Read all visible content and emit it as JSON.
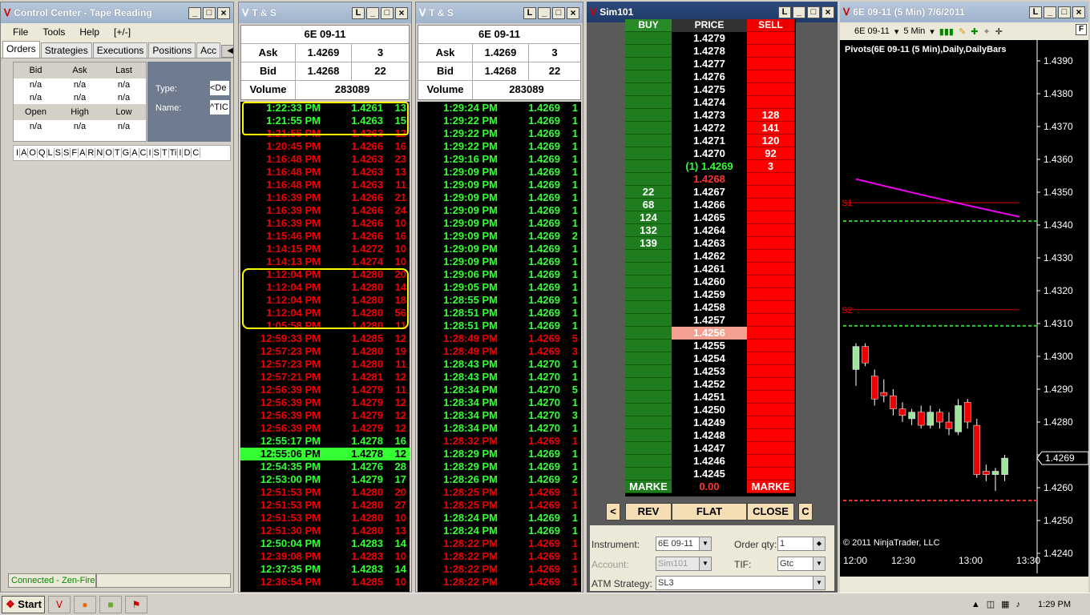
{
  "cc": {
    "title": "Control Center - Tape Reading",
    "menu": [
      "File",
      "Tools",
      "Help",
      "[+/-]"
    ],
    "tabs": [
      "Orders",
      "Strategies",
      "Executions",
      "Positions",
      "Acc"
    ],
    "quote_headers1": [
      "Bid",
      "Ask",
      "Last"
    ],
    "quote_rows1": [
      [
        "n/a",
        "n/a",
        "n/a"
      ],
      [
        "n/a",
        "n/a",
        "n/a"
      ]
    ],
    "quote_headers2": [
      "Open",
      "High",
      "Low"
    ],
    "quote_rows2": [
      [
        "n/a",
        "n/a",
        "n/a"
      ]
    ],
    "type_label": "Type:",
    "type_value": "<De",
    "name_label": "Name:",
    "name_value": "^TIC",
    "column_letters": [
      "I",
      "A",
      "O",
      "Q",
      "L",
      "S",
      "S",
      "F",
      "A",
      "R",
      "N",
      "O",
      "T",
      "G",
      "A",
      "C",
      "I",
      "S",
      "T",
      "Ti",
      "I",
      "D",
      "C"
    ],
    "status": "Connected - Zen-Fire"
  },
  "ts1": {
    "title": "T & S",
    "instrument": "6E 09-11",
    "ask_label": "Ask",
    "ask_price": "1.4269",
    "ask_size": "3",
    "bid_label": "Bid",
    "bid_price": "1.4268",
    "bid_size": "22",
    "vol_label": "Volume",
    "volume": "283089",
    "rows": [
      [
        "1:22:33 PM",
        "1.4261",
        "13",
        "g"
      ],
      [
        "1:21:55 PM",
        "1.4263",
        "15",
        "g"
      ],
      [
        "1:21:55 PM",
        "1.4263",
        "12",
        "r"
      ],
      [
        "1:20:45 PM",
        "1.4266",
        "16",
        "r"
      ],
      [
        "1:16:48 PM",
        "1.4263",
        "23",
        "r"
      ],
      [
        "1:16:48 PM",
        "1.4263",
        "13",
        "r"
      ],
      [
        "1:16:48 PM",
        "1.4263",
        "11",
        "r"
      ],
      [
        "1:16:39 PM",
        "1.4266",
        "21",
        "r"
      ],
      [
        "1:16:39 PM",
        "1.4266",
        "24",
        "r"
      ],
      [
        "1:16:39 PM",
        "1.4266",
        "10",
        "r"
      ],
      [
        "1:15:46 PM",
        "1.4266",
        "16",
        "r"
      ],
      [
        "1:14:15 PM",
        "1.4272",
        "10",
        "r"
      ],
      [
        "1:14:13 PM",
        "1.4274",
        "10",
        "r"
      ],
      [
        "1:12:04 PM",
        "1.4280",
        "20",
        "r"
      ],
      [
        "1:12:04 PM",
        "1.4280",
        "14",
        "r"
      ],
      [
        "1:12:04 PM",
        "1.4280",
        "18",
        "r"
      ],
      [
        "1:12:04 PM",
        "1.4280",
        "56",
        "r"
      ],
      [
        "1:05:58 PM",
        "1.4280",
        "11",
        "r"
      ],
      [
        "12:59:33 PM",
        "1.4285",
        "12",
        "r"
      ],
      [
        "12:57:23 PM",
        "1.4280",
        "19",
        "r"
      ],
      [
        "12:57:23 PM",
        "1.4280",
        "11",
        "r"
      ],
      [
        "12:57:21 PM",
        "1.4281",
        "12",
        "r"
      ],
      [
        "12:56:39 PM",
        "1.4279",
        "11",
        "r"
      ],
      [
        "12:56:39 PM",
        "1.4279",
        "12",
        "r"
      ],
      [
        "12:56:39 PM",
        "1.4279",
        "12",
        "r"
      ],
      [
        "12:56:39 PM",
        "1.4279",
        "12",
        "r"
      ],
      [
        "12:55:17 PM",
        "1.4278",
        "16",
        "g"
      ],
      [
        "12:55:06 PM",
        "1.4278",
        "12",
        "hl"
      ],
      [
        "12:54:35 PM",
        "1.4276",
        "28",
        "g"
      ],
      [
        "12:53:00 PM",
        "1.4279",
        "17",
        "g"
      ],
      [
        "12:51:53 PM",
        "1.4280",
        "20",
        "r"
      ],
      [
        "12:51:53 PM",
        "1.4280",
        "27",
        "r"
      ],
      [
        "12:51:53 PM",
        "1.4280",
        "10",
        "r"
      ],
      [
        "12:51:30 PM",
        "1.4280",
        "13",
        "r"
      ],
      [
        "12:50:04 PM",
        "1.4283",
        "14",
        "g"
      ],
      [
        "12:39:08 PM",
        "1.4283",
        "10",
        "r"
      ],
      [
        "12:37:35 PM",
        "1.4283",
        "14",
        "g"
      ],
      [
        "12:36:54 PM",
        "1.4285",
        "10",
        "r"
      ]
    ]
  },
  "ts2": {
    "title": "T & S",
    "instrument": "6E 09-11",
    "ask_label": "Ask",
    "ask_price": "1.4269",
    "ask_size": "3",
    "bid_label": "Bid",
    "bid_price": "1.4268",
    "bid_size": "22",
    "vol_label": "Volume",
    "volume": "283089",
    "rows": [
      [
        "1:29:24 PM",
        "1.4269",
        "1",
        "g"
      ],
      [
        "1:29:22 PM",
        "1.4269",
        "1",
        "g"
      ],
      [
        "1:29:22 PM",
        "1.4269",
        "1",
        "g"
      ],
      [
        "1:29:22 PM",
        "1.4269",
        "1",
        "g"
      ],
      [
        "1:29:16 PM",
        "1.4269",
        "1",
        "g"
      ],
      [
        "1:29:09 PM",
        "1.4269",
        "1",
        "g"
      ],
      [
        "1:29:09 PM",
        "1.4269",
        "1",
        "g"
      ],
      [
        "1:29:09 PM",
        "1.4269",
        "1",
        "g"
      ],
      [
        "1:29:09 PM",
        "1.4269",
        "1",
        "g"
      ],
      [
        "1:29:09 PM",
        "1.4269",
        "1",
        "g"
      ],
      [
        "1:29:09 PM",
        "1.4269",
        "2",
        "g"
      ],
      [
        "1:29:09 PM",
        "1.4269",
        "1",
        "g"
      ],
      [
        "1:29:09 PM",
        "1.4269",
        "1",
        "g"
      ],
      [
        "1:29:06 PM",
        "1.4269",
        "1",
        "g"
      ],
      [
        "1:29:05 PM",
        "1.4269",
        "1",
        "g"
      ],
      [
        "1:28:55 PM",
        "1.4269",
        "1",
        "g"
      ],
      [
        "1:28:51 PM",
        "1.4269",
        "1",
        "g"
      ],
      [
        "1:28:51 PM",
        "1.4269",
        "1",
        "g"
      ],
      [
        "1:28:49 PM",
        "1.4269",
        "5",
        "r"
      ],
      [
        "1:28:49 PM",
        "1.4269",
        "3",
        "r"
      ],
      [
        "1:28:43 PM",
        "1.4270",
        "1",
        "g"
      ],
      [
        "1:28:43 PM",
        "1.4270",
        "1",
        "g"
      ],
      [
        "1:28:34 PM",
        "1.4270",
        "5",
        "g"
      ],
      [
        "1:28:34 PM",
        "1.4270",
        "1",
        "g"
      ],
      [
        "1:28:34 PM",
        "1.4270",
        "3",
        "g"
      ],
      [
        "1:28:34 PM",
        "1.4270",
        "1",
        "g"
      ],
      [
        "1:28:32 PM",
        "1.4269",
        "1",
        "r"
      ],
      [
        "1:28:29 PM",
        "1.4269",
        "1",
        "g"
      ],
      [
        "1:28:29 PM",
        "1.4269",
        "1",
        "g"
      ],
      [
        "1:28:26 PM",
        "1.4269",
        "2",
        "g"
      ],
      [
        "1:28:25 PM",
        "1.4269",
        "1",
        "r"
      ],
      [
        "1:28:25 PM",
        "1.4269",
        "1",
        "r"
      ],
      [
        "1:28:24 PM",
        "1.4269",
        "1",
        "g"
      ],
      [
        "1:28:24 PM",
        "1.4269",
        "1",
        "g"
      ],
      [
        "1:28:22 PM",
        "1.4269",
        "1",
        "r"
      ],
      [
        "1:28:22 PM",
        "1.4269",
        "1",
        "r"
      ],
      [
        "1:28:22 PM",
        "1.4269",
        "1",
        "r"
      ],
      [
        "1:28:22 PM",
        "1.4269",
        "1",
        "r"
      ]
    ]
  },
  "dom": {
    "title": "Sim101",
    "hdr_buy": "BUY",
    "hdr_price": "PRICE",
    "hdr_sell": "SELL",
    "rows": [
      [
        "",
        "1.4279",
        ""
      ],
      [
        "",
        "1.4278",
        ""
      ],
      [
        "",
        "1.4277",
        ""
      ],
      [
        "",
        "1.4276",
        ""
      ],
      [
        "",
        "1.4275",
        ""
      ],
      [
        "",
        "1.4274",
        ""
      ],
      [
        "",
        "1.4273",
        "128"
      ],
      [
        "",
        "1.4272",
        "141"
      ],
      [
        "",
        "1.4271",
        "120"
      ],
      [
        "",
        "1.4270",
        "92"
      ],
      [
        "",
        "(1) 1.4269",
        "3"
      ],
      [
        "",
        "1.4268",
        ""
      ],
      [
        "22",
        "1.4267",
        ""
      ],
      [
        "68",
        "1.4266",
        ""
      ],
      [
        "124",
        "1.4265",
        ""
      ],
      [
        "132",
        "1.4264",
        ""
      ],
      [
        "139",
        "1.4263",
        ""
      ],
      [
        "",
        "1.4262",
        ""
      ],
      [
        "",
        "1.4261",
        ""
      ],
      [
        "",
        "1.4260",
        ""
      ],
      [
        "",
        "1.4259",
        ""
      ],
      [
        "",
        "1.4258",
        ""
      ],
      [
        "",
        "1.4257",
        ""
      ],
      [
        "",
        "1.4256",
        ""
      ],
      [
        "",
        "1.4255",
        ""
      ],
      [
        "",
        "1.4254",
        ""
      ],
      [
        "",
        "1.4253",
        ""
      ],
      [
        "",
        "1.4252",
        ""
      ],
      [
        "",
        "1.4251",
        ""
      ],
      [
        "",
        "1.4250",
        ""
      ],
      [
        "",
        "1.4249",
        ""
      ],
      [
        "",
        "1.4248",
        ""
      ],
      [
        "",
        "1.4247",
        ""
      ],
      [
        "",
        "1.4246",
        ""
      ],
      [
        "",
        "1.4245",
        ""
      ]
    ],
    "market_buy": "MARKE",
    "pnl": "0.00",
    "market_sell": "MARKE",
    "btn_left": "<",
    "btn_rev": "REV",
    "btn_flat": "FLAT",
    "btn_close": "CLOSE",
    "btn_c": "C",
    "instrument_label": "Instrument:",
    "instrument": "6E 09-11",
    "qty_label": "Order qty:",
    "qty": "1",
    "account_label": "Account:",
    "account": "Sim101",
    "tif_label": "TIF:",
    "tif": "Gtc",
    "atm_label": "ATM Strategy:",
    "atm": "SL3"
  },
  "chart": {
    "title": "6E 09-11 (5 Min) 7/6/2011",
    "instrument": "6E 09-11",
    "interval": "5 Min",
    "indicator": "Pivots(6E 09-11 (5 Min),Daily,DailyBars",
    "yticks": [
      "1.4390",
      "1.4380",
      "1.4370",
      "1.4360",
      "1.4350",
      "1.4340",
      "1.4330",
      "1.4320",
      "1.4310",
      "1.4300",
      "1.4290",
      "1.4280",
      "1.4270",
      "1.4260",
      "1.4250",
      "1.4240"
    ],
    "last_price": "1.4269",
    "s1": "S1",
    "s2": "S2",
    "xticks": [
      "12:00",
      "12:30",
      "13:00",
      "13:30"
    ],
    "copyright": "© 2011 NinjaTrader, LLC"
  },
  "taskbar": {
    "start": "Start",
    "clock": "1:29 PM"
  }
}
